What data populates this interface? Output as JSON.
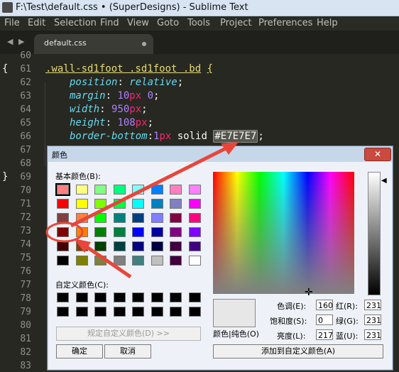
{
  "window": {
    "title": "F:\\Test\\default.css • (SuperDesigns) - Sublime Text"
  },
  "menu": [
    "File",
    "Edit",
    "Selection",
    "Find",
    "View",
    "Goto",
    "Tools",
    "Project",
    "Preferences",
    "Help"
  ],
  "tab": {
    "label": "default.css",
    "nav_left": "◀",
    "nav_right": "▶"
  },
  "editor": {
    "line_numbers": [
      "60",
      "61",
      "62",
      "63",
      "64",
      "65",
      "66",
      "67",
      "68",
      "69",
      "70",
      "71",
      "72",
      "73",
      "74",
      "75",
      "76",
      "77",
      "78",
      "79",
      "80",
      "81",
      "82",
      "83"
    ],
    "fold_open": "{",
    "fold_close": "}",
    "lines": {
      "l61": {
        "selector": ".wall-sd1foot .sd1foot .bd",
        "brace": "{"
      },
      "l62": {
        "prop": "position",
        "value": "relative"
      },
      "l63": {
        "prop": "margin",
        "num": "10",
        "unit": "px",
        "rest": "0"
      },
      "l64": {
        "prop": "width",
        "num": "950",
        "unit": "px"
      },
      "l65": {
        "prop": "height",
        "num": "108",
        "unit": "px"
      },
      "l66": {
        "prop": "border-bottom",
        "num": "1",
        "unit": "px",
        "mid": "solid",
        "color": "#E7E7E7"
      }
    }
  },
  "color_dialog": {
    "title": "颜色",
    "close_symbol": "✕",
    "basic_colors_label": "基本颜色(B):",
    "basic_colors": [
      "#ff8080",
      "#ffff80",
      "#80ff80",
      "#00ff80",
      "#80ffff",
      "#0080ff",
      "#ff80c0",
      "#ff80ff",
      "#ff0000",
      "#ffff00",
      "#80ff00",
      "#00ff40",
      "#00ffff",
      "#0080c0",
      "#8080c0",
      "#ff00ff",
      "#804040",
      "#ff8040",
      "#00ff00",
      "#008080",
      "#004080",
      "#8080ff",
      "#800040",
      "#ff0080",
      "#800000",
      "#ff8000",
      "#008000",
      "#008040",
      "#0000ff",
      "#0000a0",
      "#800080",
      "#8000ff",
      "#400000",
      "#804000",
      "#004000",
      "#004040",
      "#000080",
      "#000040",
      "#400040",
      "#400080",
      "#000000",
      "#808000",
      "#808040",
      "#808080",
      "#408080",
      "#c0c0c0",
      "#400040",
      "#ffffff"
    ],
    "custom_colors_label": "自定义颜色(C):",
    "define_custom_button": "规定自定义颜色(D) >>",
    "ok_button": "确定",
    "cancel_button": "取消",
    "solid_label": "颜色|纯色(O)",
    "hue_label": "色调(E):",
    "hue_value": "160",
    "sat_label": "饱和度(S):",
    "sat_value": "0",
    "lum_label": "亮度(L):",
    "lum_value": "217",
    "red_label": "红(R):",
    "red_value": "231",
    "green_label": "绿(G):",
    "green_value": "231",
    "blue_label": "蓝(U):",
    "blue_value": "231",
    "add_custom_button": "添加到自定义颜色(A)",
    "current_color": "#E7E7E7"
  },
  "annotation": {
    "arrow_color": "#e8463a"
  }
}
